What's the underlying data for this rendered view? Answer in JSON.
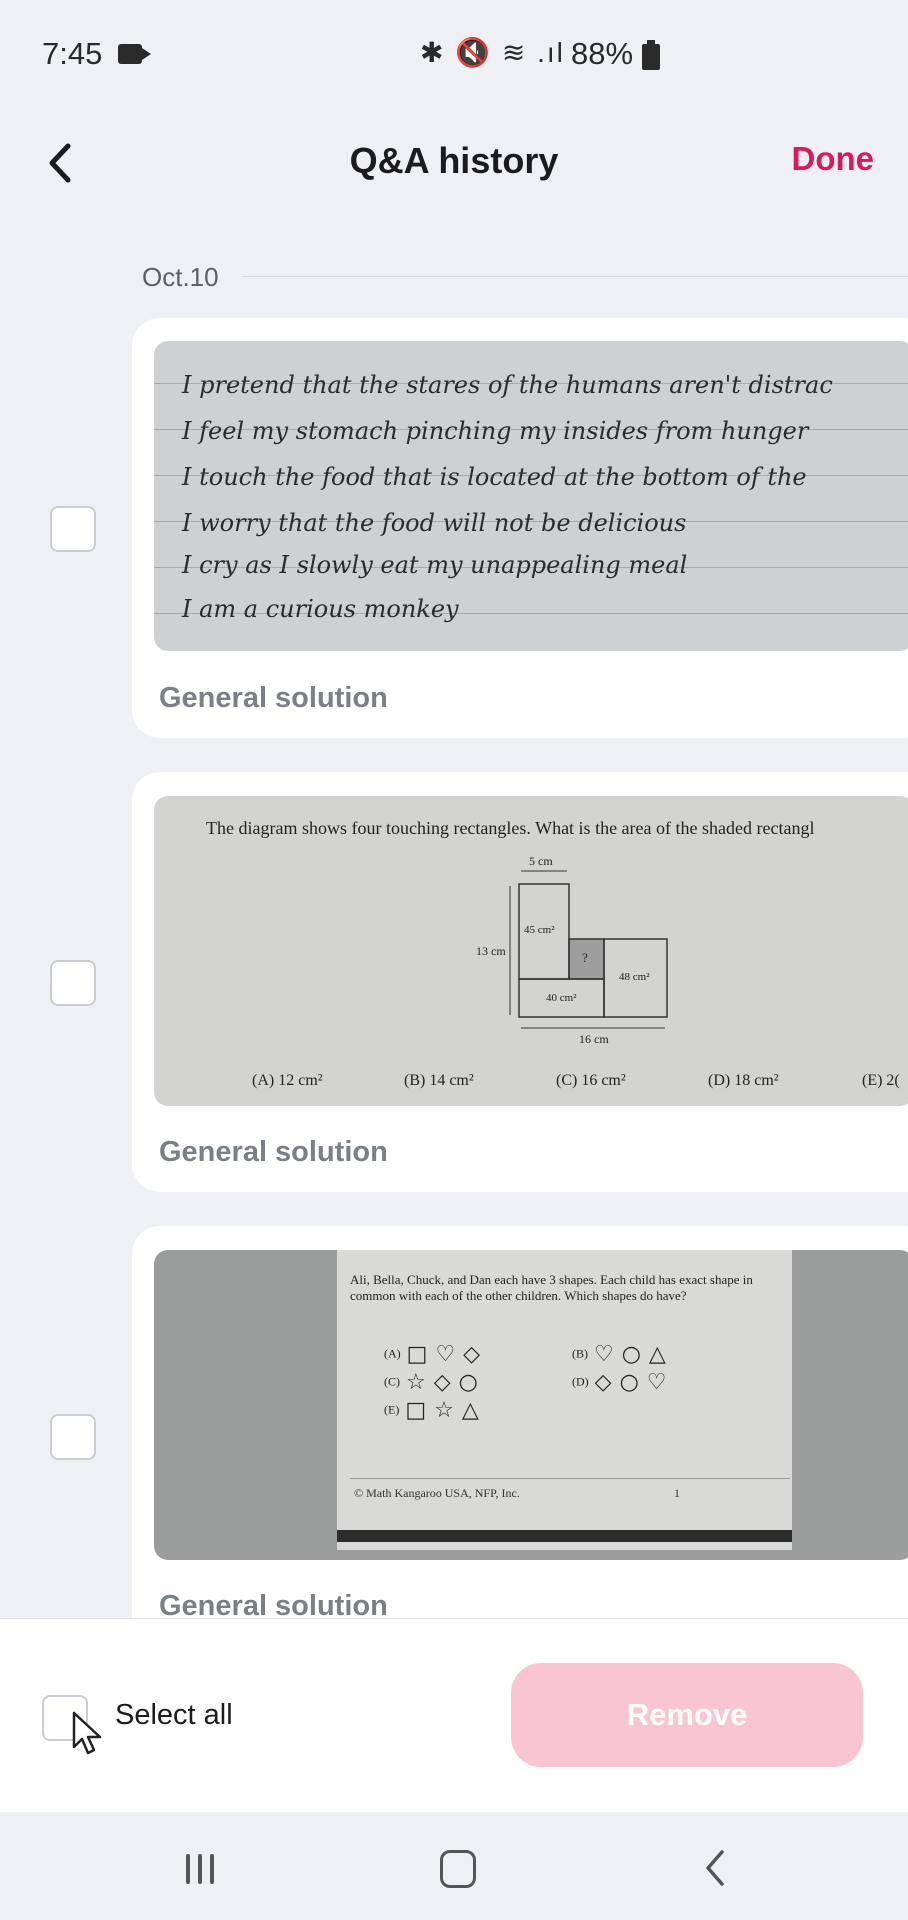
{
  "status_bar": {
    "time": "7:45",
    "icons": "✱ 🔇 ≋ .ıl",
    "battery_percent": "88%"
  },
  "header": {
    "title": "Q&A history",
    "done_label": "Done"
  },
  "date_label": "Oct.10",
  "items": [
    {
      "type": "handwriting",
      "lines": [
        "I pretend that the stares of the humans aren't distrac",
        "I feel my stomach pinching my insides from hunger",
        "I touch the food that is located at the bottom of the",
        "I worry that the food will not be delicious",
        "I cry as I slowly eat my unappealing meal",
        "I am a curious monkey"
      ],
      "label": "General solution"
    },
    {
      "type": "diagram",
      "question": "The diagram shows four touching rectangles. What is the area of the shaded rectangl",
      "diagram_labels": {
        "top": "5 cm",
        "left": "13 cm",
        "a": "45 cm²",
        "q": "?",
        "b": "48 cm²",
        "c": "40 cm²",
        "bottom": "16 cm"
      },
      "options": [
        "(A) 12 cm²",
        "(B) 14 cm²",
        "(C) 16 cm²",
        "(D) 18 cm²",
        "(E) 2("
      ],
      "label": "General solution"
    },
    {
      "type": "shapes",
      "question": "Ali, Bella, Chuck, and Dan each have 3 shapes. Each child has exact shape in common with each of the other children. Which shapes do have?",
      "options": [
        {
          "key": "(A)",
          "shapes": "□♡◇"
        },
        {
          "key": "(B)",
          "shapes": "♡○△"
        },
        {
          "key": "(C)",
          "shapes": "☆◇○"
        },
        {
          "key": "(D)",
          "shapes": "◇○♡"
        },
        {
          "key": "(E)",
          "shapes": "□☆△"
        }
      ],
      "copyright": "© Math Kangaroo USA, NFP, Inc.",
      "page": "1",
      "label": "General solution"
    }
  ],
  "footer": {
    "select_all_label": "Select all",
    "remove_label": "Remove"
  },
  "colors": {
    "accent": "#d81b60",
    "remove_disabled": "#f9c5d3",
    "background": "#eff0f4"
  }
}
